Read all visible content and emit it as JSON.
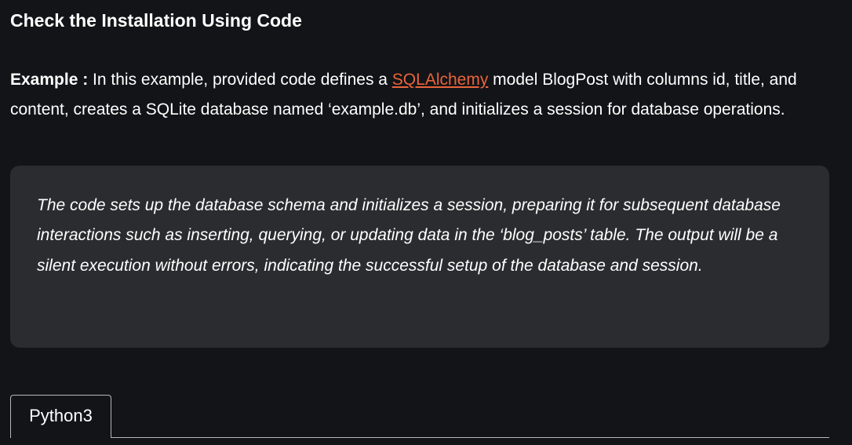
{
  "heading": "Check the Installation Using Code",
  "intro": {
    "label": "Example :",
    "text_before_link": " In this example, provided code defines a ",
    "link_text": "SQLAlchemy",
    "text_after_link": " model BlogPost with columns id, title, and content, creates a SQLite database named ‘example.db’, and initializes a session for database operations."
  },
  "callout": {
    "text": "The code sets up the database schema and initializes a session, preparing it for subsequent database interactions such as inserting, querying, or updating data in the ‘blog_posts’ table. The output will be a silent execution without errors, indicating the successful setup of the database and session."
  },
  "code_tabs": [
    {
      "label": "Python3",
      "active": true
    }
  ],
  "colors": {
    "background": "#131417",
    "callout_background": "#2b2c2f",
    "link": "#e8643c",
    "text": "#ffffff"
  }
}
